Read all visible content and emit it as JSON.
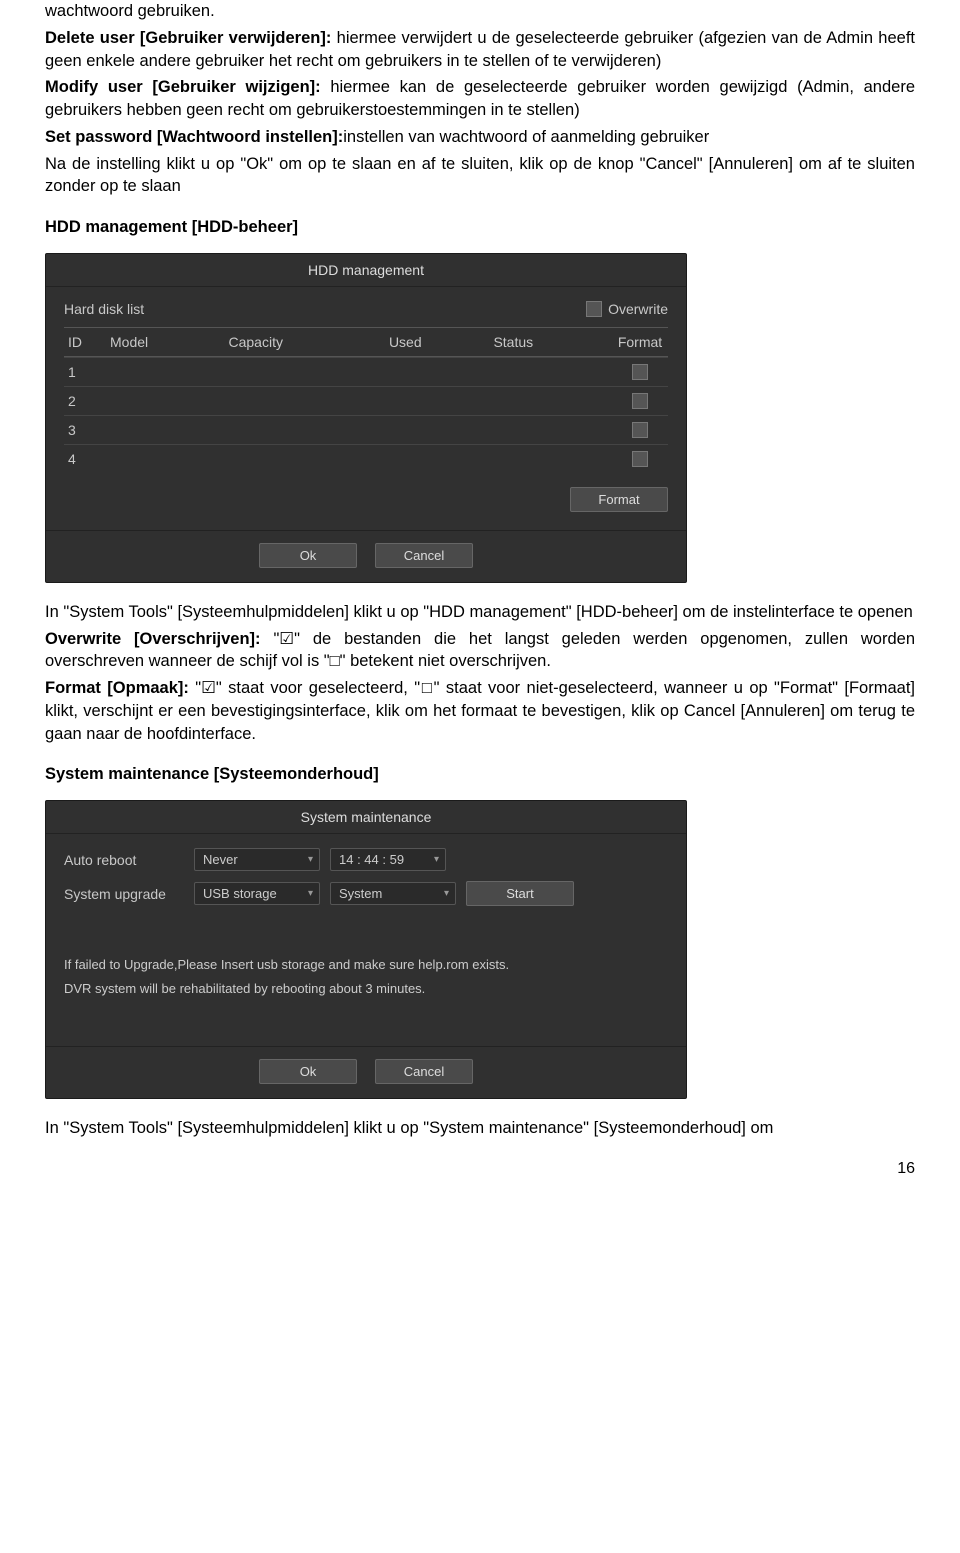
{
  "intro": {
    "line1": "wachtwoord gebruiken.",
    "delete_b": "Delete user [Gebruiker verwijderen]:",
    "delete_t": " hiermee verwijdert u de geselecteerde gebruiker (afgezien van de Admin heeft geen enkele andere gebruiker het recht om gebruikers in te stellen of te verwijderen)",
    "modify_b": "Modify user [Gebruiker wijzigen]:",
    "modify_t": " hiermee kan de geselecteerde gebruiker worden gewijzigd (Admin, andere gebruikers hebben geen recht om gebruikerstoestemmingen in te stellen)",
    "set_b": "Set password [Wachtwoord instellen]:",
    "set_t": "instellen van wachtwoord of aanmelding gebruiker",
    "note": "Na de instelling klikt u op \"Ok\" om op te slaan en af te sluiten, klik op de knop \"Cancel\" [Annuleren] om af te sluiten zonder op te slaan"
  },
  "hdd": {
    "heading": "HDD management [HDD-beheer]",
    "panel_title": "HDD management",
    "hard_disk_list": "Hard disk list",
    "overwrite": "Overwrite",
    "columns": {
      "id": "ID",
      "model": "Model",
      "capacity": "Capacity",
      "used": "Used",
      "status": "Status",
      "format": "Format"
    },
    "rows": [
      "1",
      "2",
      "3",
      "4"
    ],
    "format_btn": "Format",
    "ok": "Ok",
    "cancel": "Cancel",
    "after1": "In \"System Tools\" [Systeemhulpmiddelen] klikt u op \"HDD management\" [HDD-beheer] om de instelinterface te openen",
    "ovw_b": "Overwrite [Overschrijven]:",
    "ovw_t": " \"☑\" de bestanden die het langst geleden werden opgenomen, zullen worden overschreven wanneer de schijf vol is \"□\" betekent niet overschrijven.",
    "fmt_b": "Format [Opmaak]:",
    "fmt_t": " \"☑\" staat voor geselecteerd, \"□\" staat voor niet-geselecteerd, wanneer u op \"Format\" [Formaat] klikt, verschijnt er een bevestigingsinterface, klik om het formaat te bevestigen, klik op Cancel [Annuleren] om terug te gaan naar de hoofdinterface."
  },
  "sys": {
    "heading": "System maintenance [Systeemonderhoud]",
    "panel_title": "System maintenance",
    "auto_reboot_label": "Auto reboot",
    "auto_reboot_value": "Never",
    "time_value": "14 : 44 : 59",
    "upgrade_label": "System upgrade",
    "upgrade_value": "USB storage",
    "system_value": "System",
    "start_btn": "Start",
    "msg1": "If failed to Upgrade,Please Insert usb storage and make sure help.rom exists.",
    "msg2": "DVR system will be rehabilitated by rebooting about 3 minutes.",
    "ok": "Ok",
    "cancel": "Cancel",
    "after": "In \"System Tools\" [Systeemhulpmiddelen] klikt u op \"System maintenance\" [Systeemonderhoud] om"
  },
  "page_num": "16"
}
